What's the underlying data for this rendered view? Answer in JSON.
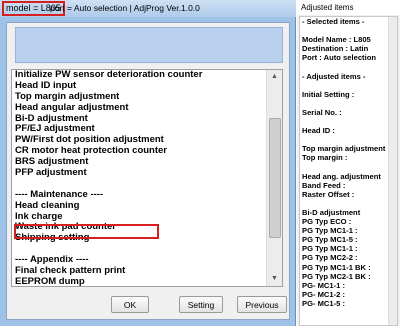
{
  "dialog": {
    "title_model": "model = L805",
    "title_rest": "port = Auto selection | AdjProg Ver.1.0.0"
  },
  "list": {
    "items": [
      "Initialize PW sensor deterioration counter",
      "Head ID input",
      "Top margin adjustment",
      "Head angular adjustment",
      "Bi-D adjustment",
      "PF/EJ adjustment",
      "PW/First dot position adjustment",
      "CR motor heat protection counter",
      "BRS adjustment",
      "PFP adjustment",
      "",
      "---- Maintenance ----",
      "Head cleaning",
      "Ink charge",
      "Waste ink pad counter",
      "Shipping setting",
      "",
      "---- Appendix ----",
      "Final check pattern print",
      "EEPROM dump"
    ],
    "highlighted": "Waste ink pad counter"
  },
  "buttons": {
    "ok": "OK",
    "setting": "Setting",
    "previous": "Previous"
  },
  "panel": {
    "title": "Adjusted items",
    "lines": [
      "- Selected items -",
      "",
      "Model Name : L805",
      "Destination : Latin",
      "Port : Auto selection",
      "",
      "- Adjusted items -",
      "",
      "Initial Setting :",
      "",
      "Serial No. :",
      "",
      "Head ID :",
      "",
      "Top margin adjustment",
      "  Top margin :",
      "",
      "Head ang. adjustment",
      "  Band Feed :",
      "  Raster Offset :",
      "",
      "Bi-D adjustment",
      "  PG Typ ECO :",
      "  PG Typ MC1-1 :",
      "  PG Typ MC1-5 :",
      "  PG Typ MC1-1 :",
      "  PG Typ MC2-2 :",
      "  PG Typ MC1-1 BK :",
      "  PG Typ MC2-1 BK :",
      "  PG- MC1-1 :",
      "  PG- MC1-2 :",
      "  PG- MC1-5 :"
    ]
  }
}
